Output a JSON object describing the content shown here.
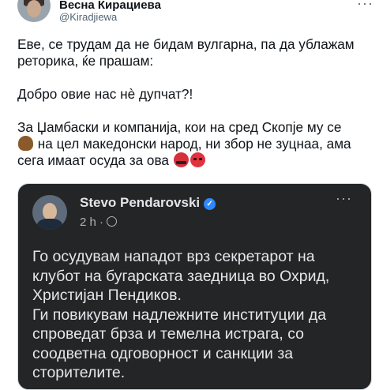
{
  "header": {
    "name": "Весна Кирациева",
    "handle": "@Kiradjiewa",
    "more_icon": "more-horizontal-icon"
  },
  "tweet": {
    "lines": [
      "Еве, се трудам да не бидам вулгарна, па да ублажам",
      "реторика, ќе прашам:",
      "",
      "Добро овие нас нè дупчат?!",
      "",
      "За Џамбаски и компанија, кои на сред Скопје му се",
      "на цел македонски народ, ни збор не зуцнаа, ама",
      "сега имаат осуда за ова"
    ],
    "emojis": [
      "pile-of-poo-emoji",
      "face-with-symbols-on-mouth-emoji",
      "pouting-face-emoji"
    ]
  },
  "card": {
    "name": "Stevo Pendarovski",
    "verified_icon": "verified-badge-icon",
    "time": "2 h ·",
    "privacy_icon": "globe-icon",
    "more_icon": "more-horizontal-icon",
    "lines": [
      "Го осудувам нападот врз секретарот на",
      "клубот на бугарската заедница во Охрид,",
      "Христијан Пендиков.",
      "Ги повикувам надлежните институции да",
      "спроведат брза и темелна истрага, со",
      "соодветна одговорност и санкции за",
      "сторителите."
    ]
  },
  "colors": {
    "text": "#0f1419",
    "secondary": "#536471",
    "card_bg": "#242526",
    "card_text": "#e4e6eb",
    "verified": "#2d88ff"
  }
}
